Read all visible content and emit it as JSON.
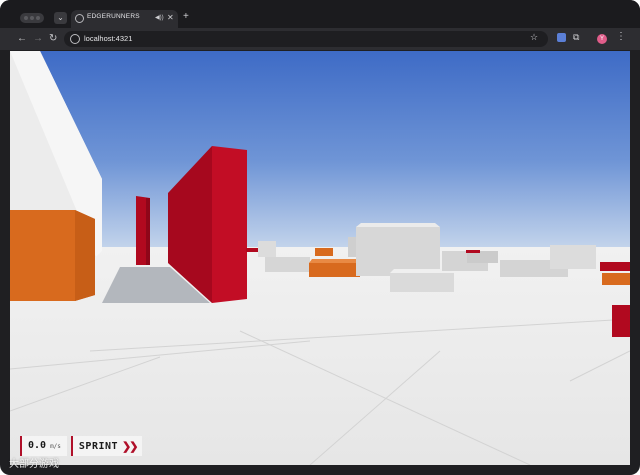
{
  "browser": {
    "tab_title": "EDGERUNNERS",
    "tab_list_icon": "chevron-down-icon",
    "new_tab_icon": "plus-icon",
    "url": "localhost:4321",
    "profile_initial": "Y"
  },
  "hud": {
    "speed_value": "0.0",
    "speed_unit": "m/s",
    "mode_label": "SPRINT",
    "mode_icon": "double-chevron-right-icon"
  },
  "watermark": "大部分游戏",
  "colors": {
    "accent": "#b0102a",
    "sky_top": "#3e6bc6",
    "sky_horizon": "#b9cde8",
    "ground": "#e9e9e9",
    "red_pillar": "#a6081e",
    "orange_block": "#d86a1e"
  }
}
